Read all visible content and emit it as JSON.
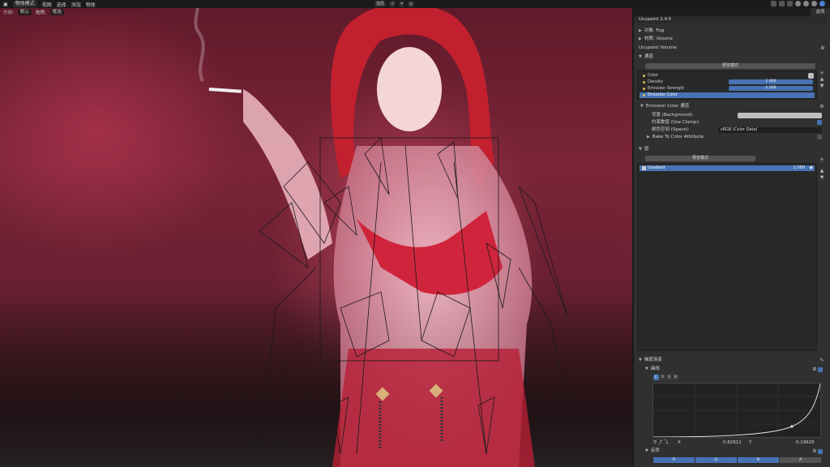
{
  "header": {
    "mode": "物体模式",
    "menus": [
      "视图",
      "选择",
      "添加",
      "物体"
    ],
    "orientation_label": "方向:",
    "orientation_value": "默认",
    "drag_label": "拖拽:",
    "drag_value": "框选",
    "transform_space": "选局",
    "right_tab": "选项"
  },
  "panel": {
    "title": "Ucupaint 2.4.5",
    "object_row": "对象: Fog",
    "material_row": "材质: Volume",
    "node_row": "Ucupaint Volume",
    "channels_header": "通道",
    "preview_mode": "预览模式",
    "channels": [
      {
        "label": "Color",
        "value": ""
      },
      {
        "label": "Density",
        "value": "1.000"
      },
      {
        "label": "Emission Strength",
        "value": "1.500"
      },
      {
        "label": "Emission Color",
        "value": ""
      }
    ],
    "channel_settings_header": "Emission Color 通道",
    "background_label": "背景 (Background):",
    "use_clamp_label": "约束数值 (Use Clamp):",
    "color_space_label": "颜色空间 (Space):",
    "color_space_value": "sRGB (Color Data)",
    "bake_label": "Bake To Color Attribute:",
    "layers_header": "层",
    "layers_preview": "预览模式",
    "layer_items": [
      {
        "label": "Gradient",
        "value": "1.000"
      }
    ],
    "gradient_header": "梯度渐变",
    "curve_header": "曲线",
    "curve_channels": [
      "C",
      "R",
      "G",
      "B"
    ],
    "curve_x_label": "X",
    "curve_x_value": "0.82911",
    "curve_y_label": "Y",
    "curve_y_value": "0.19625",
    "invert_header": "反转",
    "invert_channels": [
      "R",
      "G",
      "B",
      "A"
    ]
  }
}
